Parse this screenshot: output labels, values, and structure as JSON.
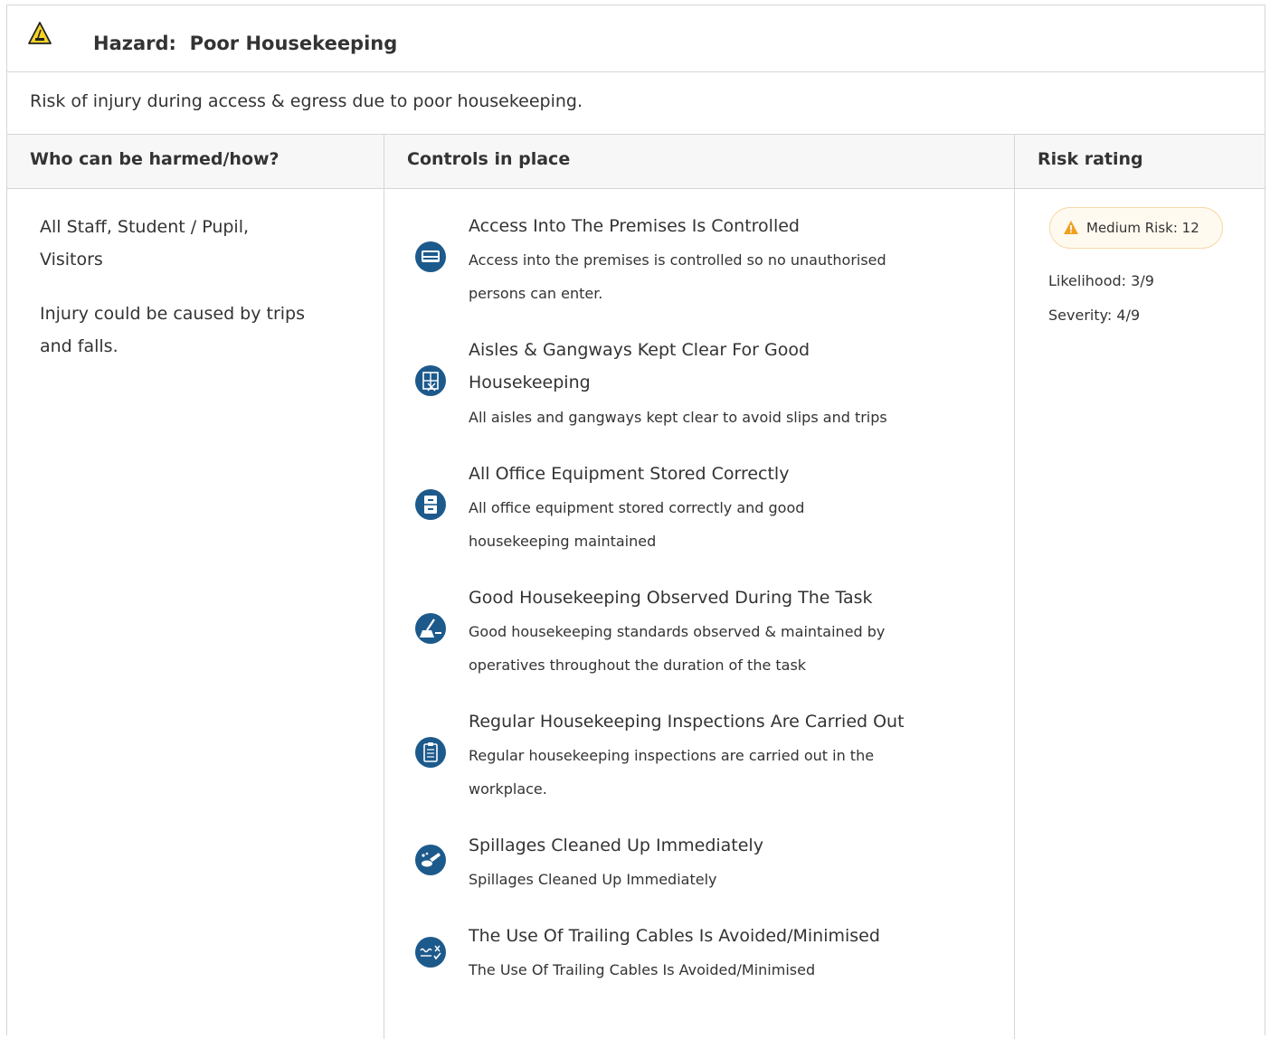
{
  "hazard": {
    "label": "Hazard:",
    "name": "Poor Housekeeping",
    "description": "Risk of injury during access & egress due to poor housekeeping."
  },
  "table": {
    "headers": {
      "who": "Who can be harmed/how?",
      "controls": "Controls in place",
      "risk": "Risk rating"
    },
    "who": {
      "groups_line1": "All Staff, Student / Pupil,",
      "groups_line2": "Visitors",
      "how_line1": "Injury could be caused by trips",
      "how_line2": "and falls."
    },
    "controls": [
      {
        "icon": "pass-card-icon",
        "title": "Access Into The Premises Is Controlled",
        "desc_line1": "Access into the premises is controlled so no unauthorised",
        "desc_line2": "persons can enter."
      },
      {
        "icon": "aisle-gangway-icon",
        "title_line1": "Aisles & Gangways Kept Clear For Good",
        "title_line2": "Housekeeping",
        "desc_line1": "All aisles and gangways kept clear to avoid slips and trips"
      },
      {
        "icon": "filing-cabinet-icon",
        "title": "All Office Equipment Stored Correctly",
        "desc_line1": "All office equipment stored correctly and good",
        "desc_line2": "housekeeping maintained"
      },
      {
        "icon": "sweeping-icon",
        "title": "Good Housekeeping Observed During The Task",
        "desc_line1": "Good housekeeping standards observed & maintained by",
        "desc_line2": "operatives throughout the duration of the task"
      },
      {
        "icon": "clipboard-checklist-icon",
        "title": "Regular Housekeeping Inspections Are Carried Out",
        "desc_line1": "Regular housekeeping inspections are carried out in the",
        "desc_line2": "workplace."
      },
      {
        "icon": "spill-cleanup-icon",
        "title": "Spillages Cleaned Up Immediately",
        "desc_line1": "Spillages Cleaned Up Immediately"
      },
      {
        "icon": "trailing-cable-icon",
        "title": "The Use Of Trailing Cables Is Avoided/Minimised",
        "desc_line1": "The Use Of Trailing Cables Is Avoided/Minimised"
      }
    ],
    "risk": {
      "badge": "Medium Risk: 12",
      "likelihood": "Likelihood: 3/9",
      "severity": "Severity: 4/9"
    }
  },
  "colors": {
    "icon_blue": "#1d5a8c",
    "warning_orange": "#f0a020",
    "border": "#d6d6d6"
  }
}
